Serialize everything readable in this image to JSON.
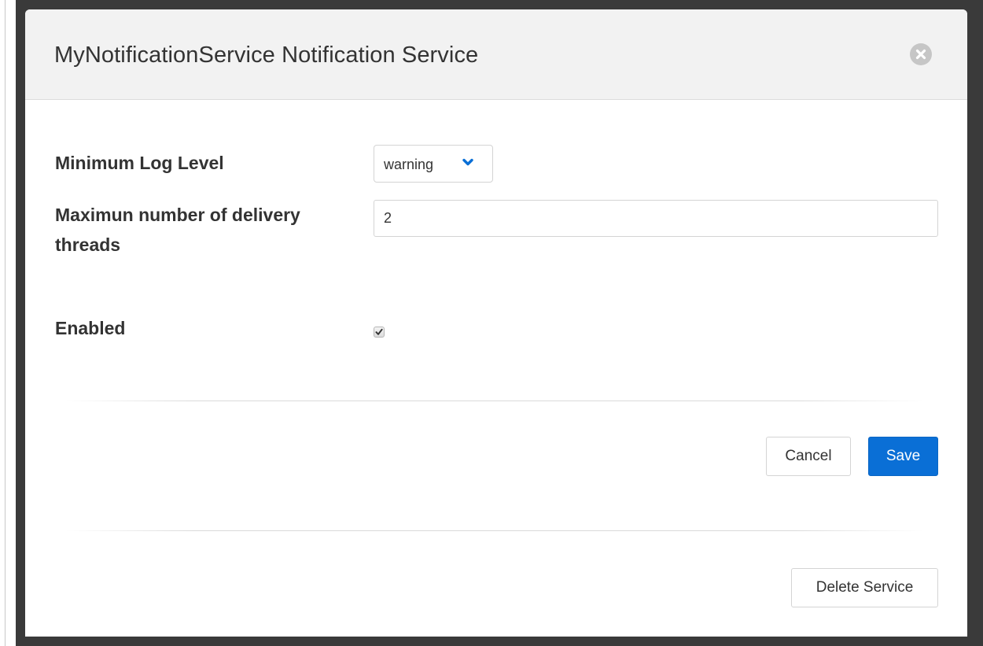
{
  "modal": {
    "title": "MyNotificationService Notification Service",
    "close_icon": "close-circle-icon"
  },
  "form": {
    "log_level": {
      "label": "Minimum Log Level",
      "value": "warning",
      "icon": "chevron-down-icon",
      "accent": "#0a6fd6"
    },
    "threads": {
      "label": "Maximun number of delivery threads",
      "value": "2"
    },
    "enabled": {
      "label": "Enabled",
      "checked": true,
      "icon": "checkmark-icon"
    }
  },
  "actions": {
    "cancel_label": "Cancel",
    "save_label": "Save",
    "delete_label": "Delete Service",
    "save_color": "#0a6fd6"
  }
}
